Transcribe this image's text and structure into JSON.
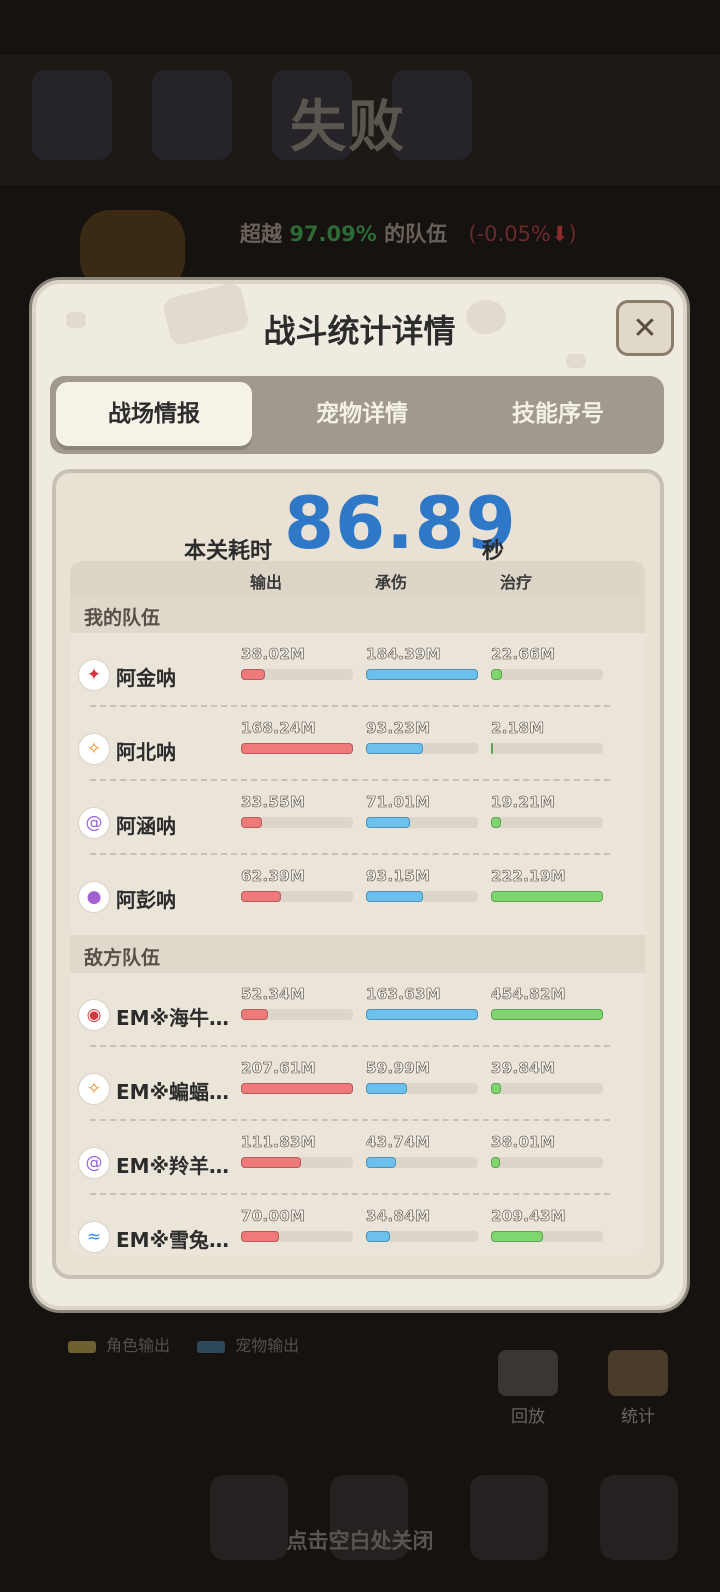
{
  "background": {
    "result_title": "失败",
    "rank_prefix": "超越",
    "rank_pct": "97.09%",
    "rank_suffix": "的队伍",
    "rank_delta": "(-0.05%",
    "legend_role": "角色输出",
    "legend_pet": "宠物输出",
    "btn_replay": "回放",
    "btn_stats": "统计",
    "close_hint": "点击空白处关闭"
  },
  "dialog": {
    "title": "战斗统计详情",
    "close_icon": "close-icon",
    "tabs": [
      "战场情报",
      "宠物详情",
      "技能序号"
    ],
    "active_tab": 0,
    "time_label": "本关耗时",
    "time_value": "86.89",
    "time_unit": "秒",
    "columns": [
      "输出",
      "承伤",
      "治疗"
    ]
  },
  "colors": {
    "output": "#f07a7a",
    "taken": "#6cc0ee",
    "heal": "#7fd66e",
    "time": "#2f78c8"
  },
  "my_team": {
    "label": "我的队伍",
    "members": [
      {
        "name": "阿金呐",
        "icon": "red-element-icon",
        "glyph": "✦",
        "color": "#d8363f",
        "output": "38.02M",
        "output_pct": 0.21,
        "taken": "184.39M",
        "taken_pct": 1.0,
        "heal": "22.66M",
        "heal_pct": 0.1
      },
      {
        "name": "阿北呐",
        "icon": "orange-element-icon",
        "glyph": "✧",
        "color": "#ee8a1c",
        "output": "168.24M",
        "output_pct": 1.0,
        "taken": "93.23M",
        "taken_pct": 0.51,
        "heal": "2.18M",
        "heal_pct": 0.01
      },
      {
        "name": "阿涵呐",
        "icon": "purple-swirl-icon",
        "glyph": "@",
        "color": "#9a63d6",
        "output": "33.55M",
        "output_pct": 0.19,
        "taken": "71.01M",
        "taken_pct": 0.39,
        "heal": "19.21M",
        "heal_pct": 0.09
      },
      {
        "name": "阿彭呐",
        "icon": "purple-orb-icon",
        "glyph": "●",
        "color": "#a45fd2",
        "output": "62.39M",
        "output_pct": 0.36,
        "taken": "93.15M",
        "taken_pct": 0.51,
        "heal": "222.19M",
        "heal_pct": 1.0
      }
    ]
  },
  "enemy_team": {
    "label": "敌方队伍",
    "members": [
      {
        "name": "EM※海牛…",
        "icon": "red-element-icon",
        "glyph": "◉",
        "color": "#d8363f",
        "output": "52.34M",
        "output_pct": 0.24,
        "taken": "163.63M",
        "taken_pct": 1.0,
        "heal": "454.82M",
        "heal_pct": 1.0
      },
      {
        "name": "EM※蝙蝠…",
        "icon": "orange-element-icon",
        "glyph": "✧",
        "color": "#ee8a1c",
        "output": "207.61M",
        "output_pct": 1.0,
        "taken": "59.99M",
        "taken_pct": 0.37,
        "heal": "39.84M",
        "heal_pct": 0.09
      },
      {
        "name": "EM※羚羊…",
        "icon": "purple-swirl-icon",
        "glyph": "@",
        "color": "#9a63d6",
        "output": "111.83M",
        "output_pct": 0.54,
        "taken": "43.74M",
        "taken_pct": 0.27,
        "heal": "38.01M",
        "heal_pct": 0.08
      },
      {
        "name": "EM※雪兔…",
        "icon": "blue-wave-icon",
        "glyph": "≈",
        "color": "#3a8ee0",
        "output": "70.00M",
        "output_pct": 0.34,
        "taken": "34.84M",
        "taken_pct": 0.21,
        "heal": "209.43M",
        "heal_pct": 0.46
      }
    ]
  }
}
